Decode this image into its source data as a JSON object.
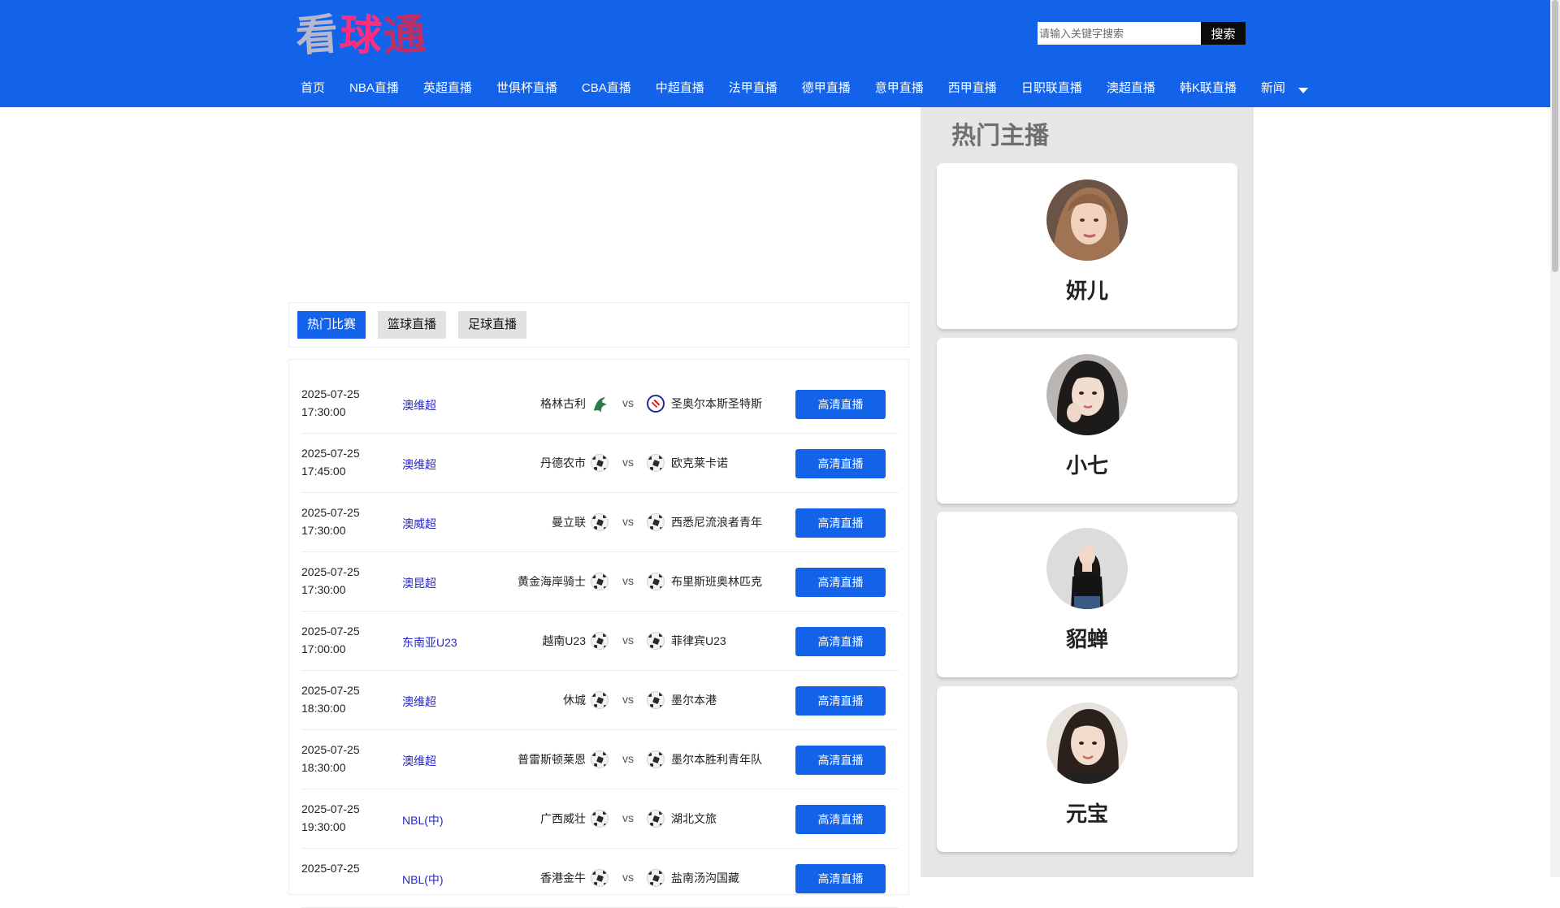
{
  "logo": {
    "chars": [
      "看",
      "球",
      "通"
    ]
  },
  "search": {
    "placeholder": "请输入关键字搜索",
    "button_label": "搜索"
  },
  "nav": {
    "items": [
      "首页",
      "NBA直播",
      "英超直播",
      "世俱杯直播",
      "CBA直播",
      "中超直播",
      "法甲直播",
      "德甲直播",
      "意甲直播",
      "西甲直播",
      "日职联直播",
      "澳超直播",
      "韩K联直播",
      "新闻"
    ],
    "dropdown_icon": "caret-down-icon"
  },
  "tabs": [
    "热门比赛",
    "篮球直播",
    "足球直播"
  ],
  "active_tab": "热门比赛",
  "matches": [
    {
      "date": "2025-07-25",
      "time": "17:30:00",
      "league": "澳维超",
      "home": "格林古利",
      "vs": "vs",
      "away": "圣奥尔本斯圣特斯",
      "button": "高清直播"
    },
    {
      "date": "2025-07-25",
      "time": "17:45:00",
      "league": "澳维超",
      "home": "丹德农市",
      "vs": "vs",
      "away": "欧克莱卡诺",
      "button": "高清直播"
    },
    {
      "date": "2025-07-25",
      "time": "17:30:00",
      "league": "澳威超",
      "home": "曼立联",
      "vs": "vs",
      "away": "西悉尼流浪者青年",
      "button": "高清直播"
    },
    {
      "date": "2025-07-25",
      "time": "17:30:00",
      "league": "澳昆超",
      "home": "黄金海岸骑士",
      "vs": "vs",
      "away": "布里斯班奥林匹克",
      "button": "高清直播"
    },
    {
      "date": "2025-07-25",
      "time": "17:00:00",
      "league": "东南亚U23",
      "home": "越南U23",
      "vs": "vs",
      "away": "菲律宾U23",
      "button": "高清直播"
    },
    {
      "date": "2025-07-25",
      "time": "18:30:00",
      "league": "澳维超",
      "home": "休城",
      "vs": "vs",
      "away": "墨尔本港",
      "button": "高清直播"
    },
    {
      "date": "2025-07-25",
      "time": "18:30:00",
      "league": "澳维超",
      "home": "普雷斯顿莱恩",
      "vs": "vs",
      "away": "墨尔本胜利青年队",
      "button": "高清直播"
    },
    {
      "date": "2025-07-25",
      "time": "19:30:00",
      "league": "NBL(中)",
      "home": "广西威壮",
      "vs": "vs",
      "away": "湖北文旅",
      "button": "高清直播"
    },
    {
      "date": "2025-07-25",
      "time": "",
      "league": "NBL(中)",
      "home": "香港金牛",
      "vs": "vs",
      "away": "盐南汤沟国藏",
      "button": "高清直播"
    }
  ],
  "sidebar": {
    "title": "热门主播",
    "streamers": [
      {
        "name": "妍儿"
      },
      {
        "name": "小七"
      },
      {
        "name": "貂蝉"
      },
      {
        "name": "元宝"
      }
    ]
  },
  "colors": {
    "header_bg": "#1263ea",
    "accent": "#1263ea",
    "league_link": "#2828c8"
  }
}
